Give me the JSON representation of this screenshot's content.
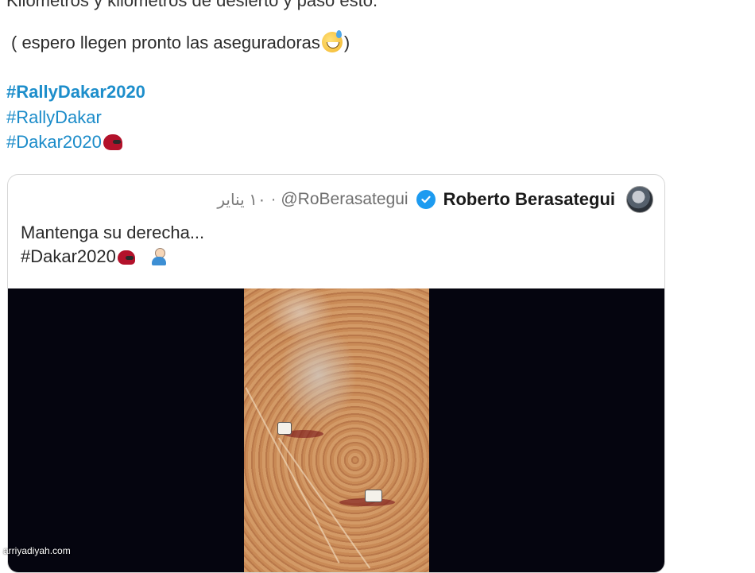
{
  "tweet": {
    "cut_line": "Kilómetros y kilómetros de desierto y paso esto.",
    "line": "( espero llegen pronto las aseguradoras",
    "line_close": ")",
    "hashtags": [
      "#RallyDakar2020",
      "#RallyDakar",
      "#Dakar2020"
    ]
  },
  "quoted_tweet": {
    "name": "Roberto Berasategui",
    "handle": "@RoBerasategui",
    "separator": "·",
    "time": "١٠ يناير",
    "text_line1": "Mantenga su derecha...",
    "text_line2": "#Dakar2020"
  },
  "watermark": "arriyadiyah.com",
  "colors": {
    "hashtag": "#1a8bc9",
    "verified": "#1d9bf0",
    "video_bg": "#05050f"
  },
  "icons": [
    "sweat-smile-emoji",
    "helmet-emoji",
    "verified-badge-icon",
    "person-emoji",
    "avatar"
  ]
}
